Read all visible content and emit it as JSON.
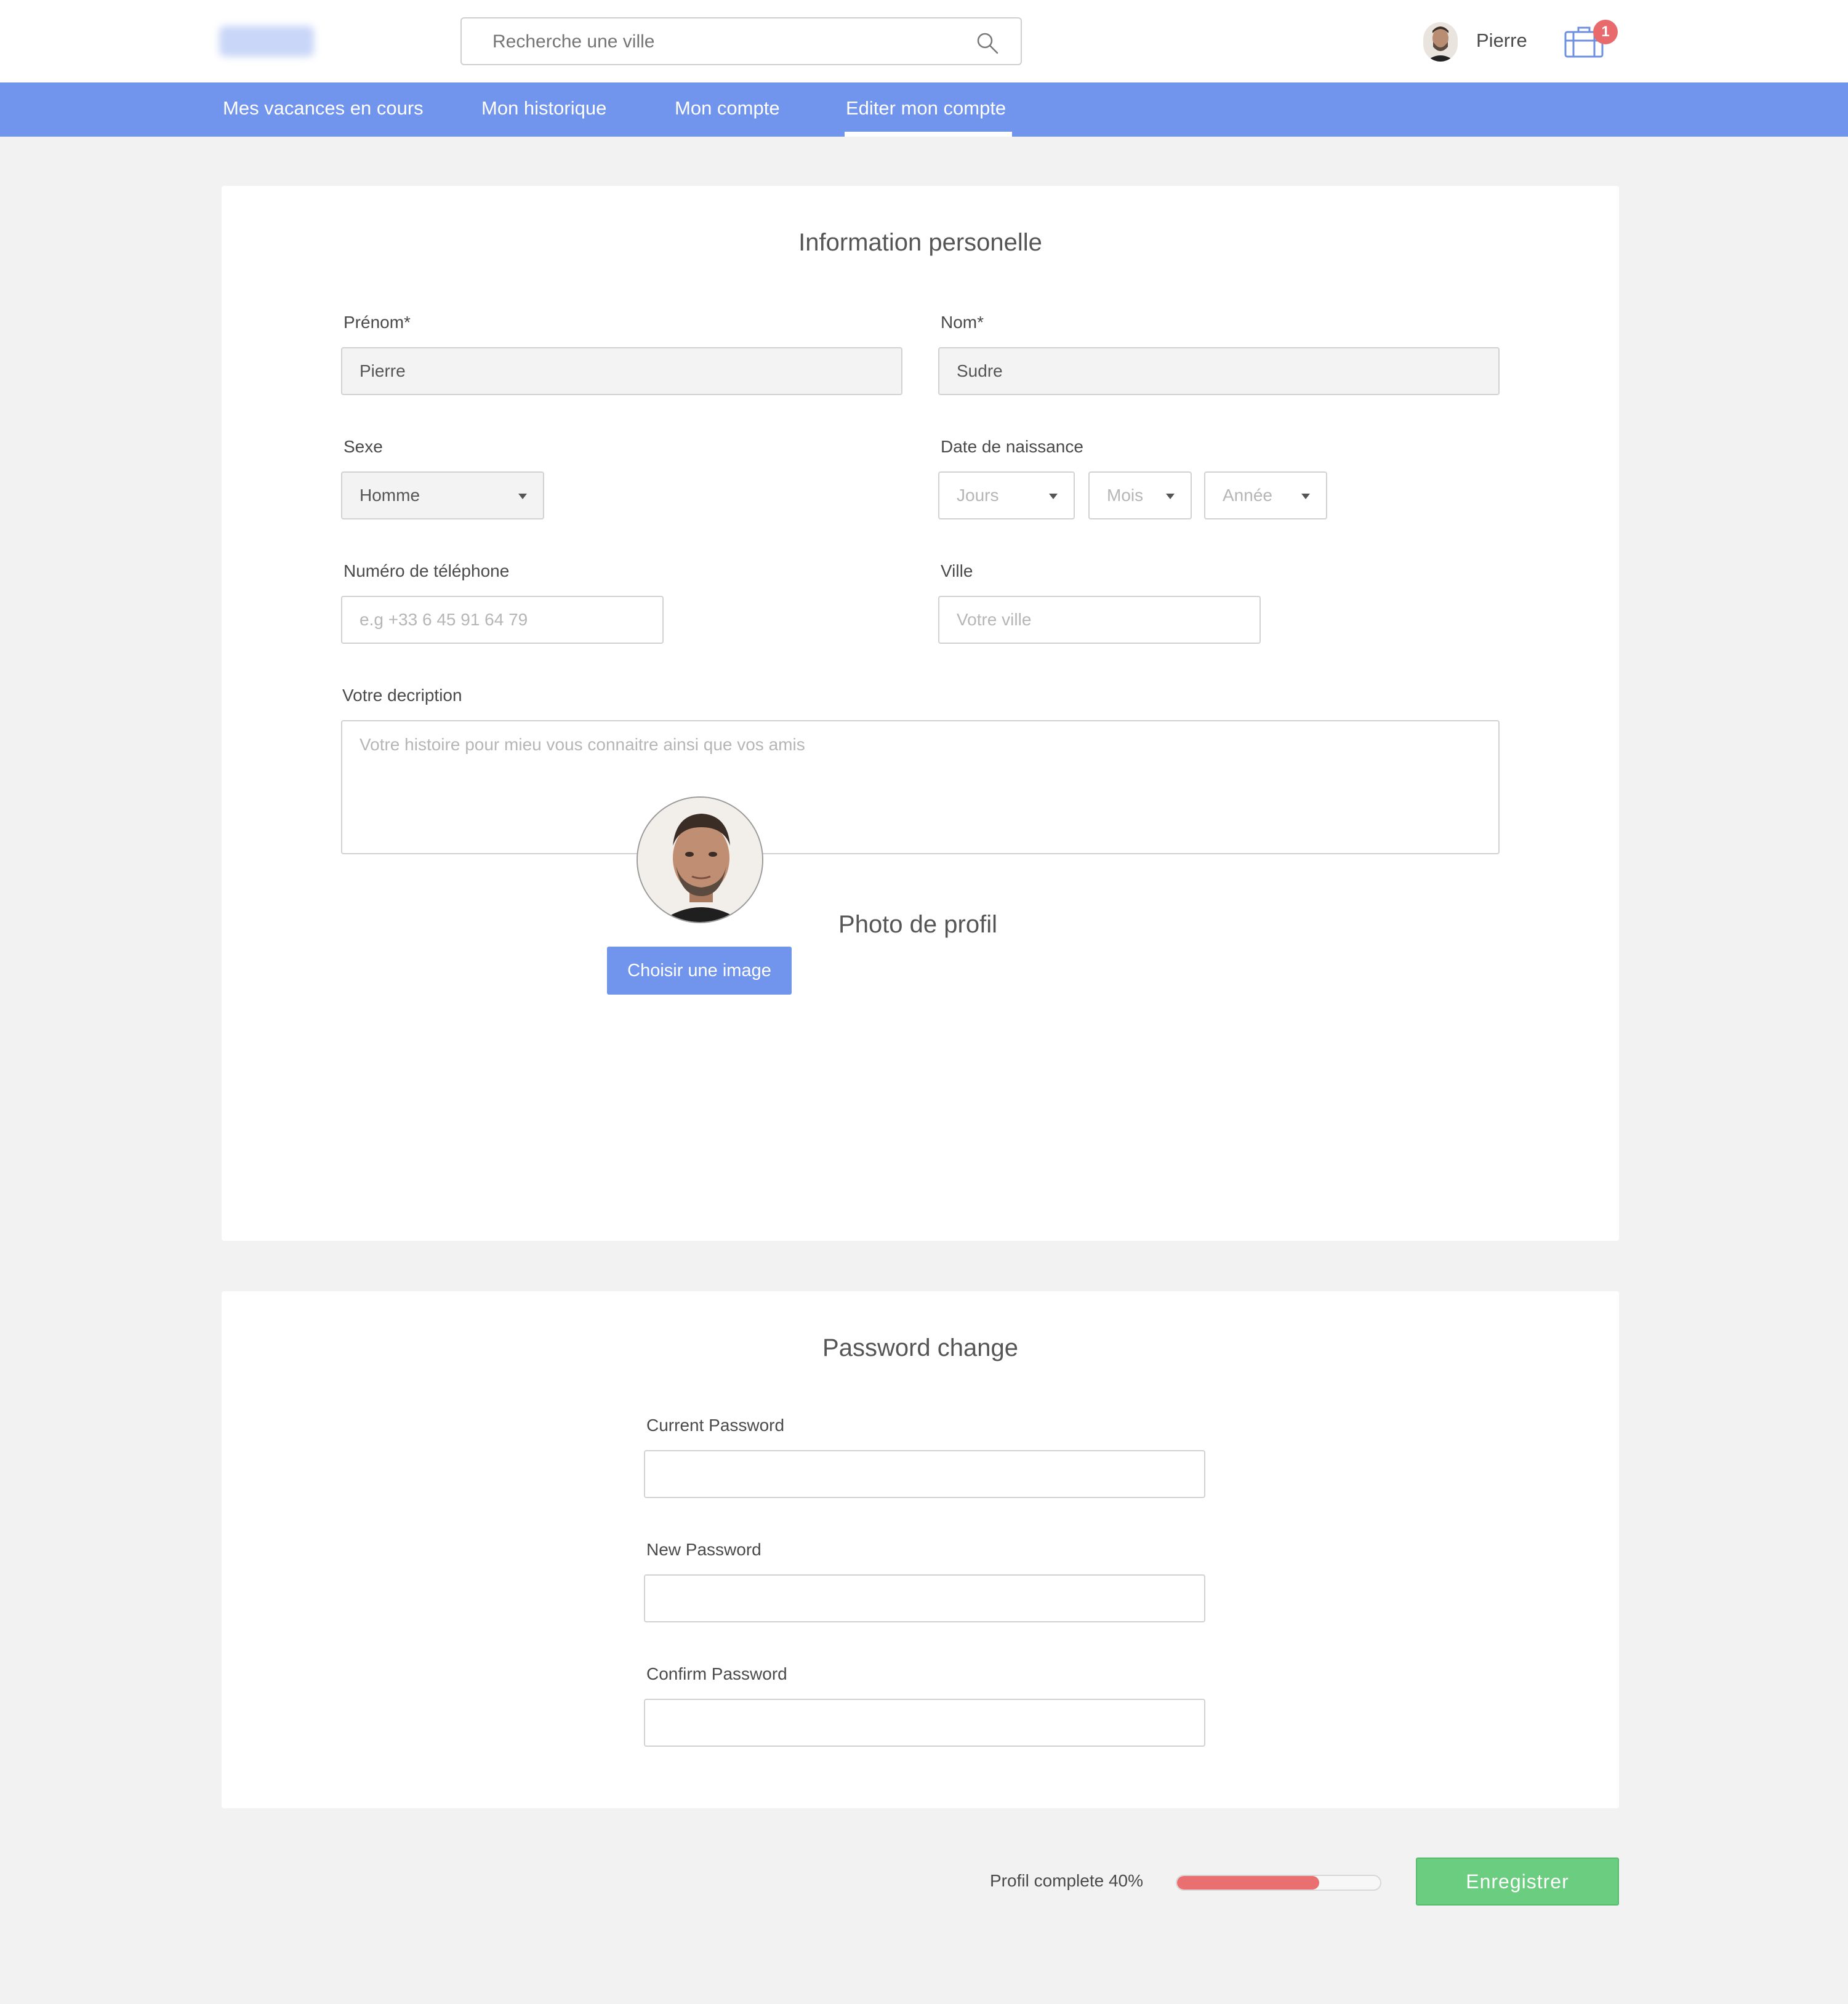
{
  "header": {
    "search_placeholder": "Recherche une ville",
    "user_name": "Pierre",
    "cart_count": "1"
  },
  "nav": {
    "items": [
      {
        "label": "Mes vacances en cours"
      },
      {
        "label": "Mon historique"
      },
      {
        "label": "Mon compte"
      },
      {
        "label": "Editer mon compte",
        "active": true
      }
    ]
  },
  "personal": {
    "title": "Information personelle",
    "firstname_label": "Prénom*",
    "firstname_value": "Pierre",
    "lastname_label": "Nom*",
    "lastname_value": "Sudre",
    "sex_label": "Sexe",
    "sex_value": "Homme",
    "birthdate_label": "Date de naissance",
    "day_placeholder": "Jours",
    "month_placeholder": "Mois",
    "year_placeholder": "Année",
    "phone_label": "Numéro de téléphone",
    "phone_placeholder": "e.g +33 6 45 91 64 79",
    "city_label": "Ville",
    "city_placeholder": "Votre ville",
    "description_label": "Votre decription",
    "description_placeholder": "Votre histoire pour mieu vous connaitre ainsi que vos amis",
    "photo_title": "Photo de profil",
    "choose_image_label": "Choisir une image"
  },
  "password": {
    "title": "Password change",
    "current_label": "Current Password",
    "new_label": "New Password",
    "confirm_label": "Confirm Password"
  },
  "footer": {
    "progress_label": "Profil complete 40%",
    "progress_value": 0.7,
    "save_label": "Enregistrer"
  },
  "colors": {
    "brand_blue": "#7195ec",
    "progress_red": "#e96f70",
    "save_green": "#6acd7f",
    "badge_red": "#e96a6d"
  }
}
